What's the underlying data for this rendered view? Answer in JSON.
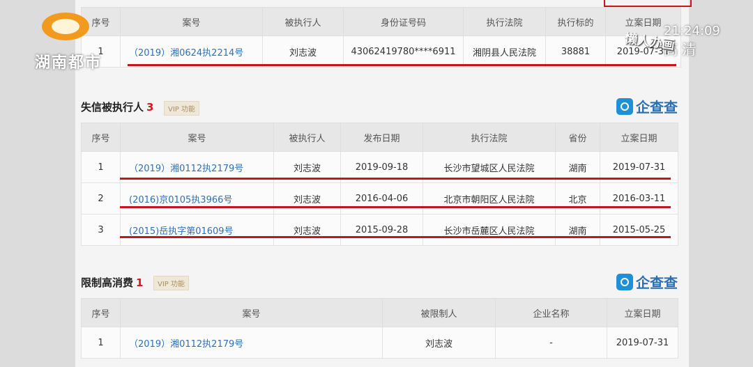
{
  "table1": {
    "headers": [
      "序号",
      "案号",
      "被执行人",
      "身份证号码",
      "执行法院",
      "执行标的",
      "立案日期"
    ],
    "rows": [
      {
        "no": "1",
        "case": "（2019）湘0624执2214号",
        "person": "刘志波",
        "id": "43062419780****6911",
        "court": "湘阴县人民法院",
        "amount": "38881",
        "date": "2019-07-31"
      }
    ]
  },
  "section2": {
    "title": "失信被执行人",
    "count": "3",
    "vip": "VIP 功能",
    "brand": "企查查"
  },
  "table2": {
    "headers": [
      "序号",
      "案号",
      "被执行人",
      "发布日期",
      "执行法院",
      "省份",
      "立案日期"
    ],
    "rows": [
      {
        "no": "1",
        "case": "（2019）湘0112执2179号",
        "person": "刘志波",
        "pub": "2019-09-18",
        "court": "长沙市望城区人民法院",
        "prov": "湖南",
        "date": "2019-07-31"
      },
      {
        "no": "2",
        "case": "(2016)京0105执3966号",
        "person": "刘志波",
        "pub": "2016-04-06",
        "court": "北京市朝阳区人民法院",
        "prov": "北京",
        "date": "2016-03-11"
      },
      {
        "no": "3",
        "case": "(2015)岳执字第01609号",
        "person": "刘志波",
        "pub": "2015-09-28",
        "court": "长沙市岳麓区人民法院",
        "prov": "湖南",
        "date": "2015-05-25"
      }
    ]
  },
  "section3": {
    "title": "限制高消费",
    "count": "1",
    "vip": "VIP 功能",
    "brand": "企查查"
  },
  "table3": {
    "headers": [
      "序号",
      "案号",
      "被限制人",
      "企业名称",
      "立案日期"
    ],
    "rows": [
      {
        "no": "1",
        "case": "（2019）湘0112执2179号",
        "person": "刘志波",
        "company": "-",
        "date": "2019-07-31"
      }
    ]
  },
  "overlay": {
    "channel": "湖南都市",
    "clock": "21:24:09",
    "hd": "高 清",
    "caption": "懒人办画"
  },
  "colors": {
    "accent_red": "#c8141e",
    "link_blue": "#2f6fb6",
    "brand_blue": "#2c6fb0",
    "logo_orange": "#f29a1e"
  }
}
